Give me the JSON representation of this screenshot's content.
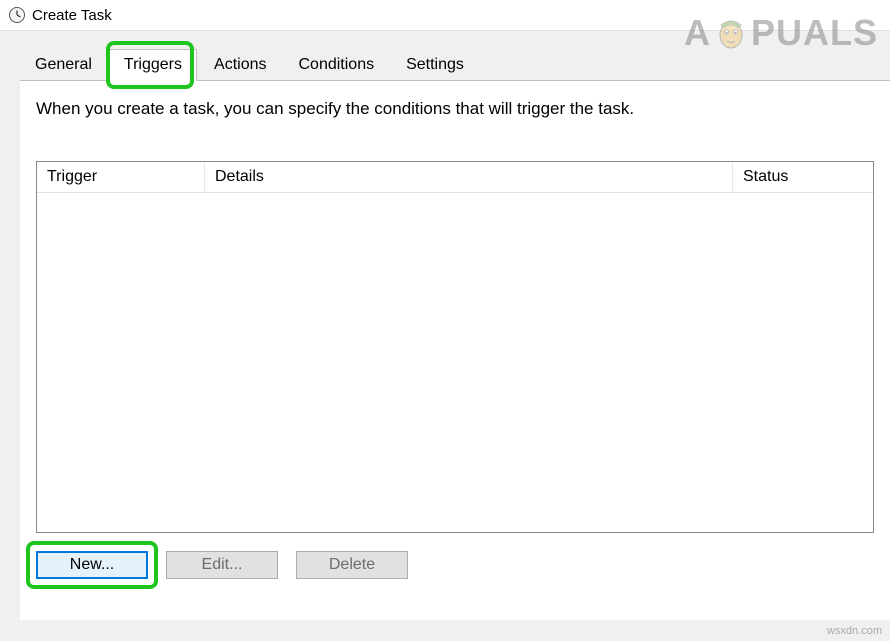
{
  "window": {
    "title": "Create Task"
  },
  "watermark": {
    "prefix": "A",
    "suffix": "PUALS"
  },
  "tabs": {
    "general": "General",
    "triggers": "Triggers",
    "actions": "Actions",
    "conditions": "Conditions",
    "settings": "Settings"
  },
  "panel": {
    "description": "When you create a task, you can specify the conditions that will trigger the task."
  },
  "table": {
    "columns": {
      "trigger": "Trigger",
      "details": "Details",
      "status": "Status"
    },
    "rows": []
  },
  "buttons": {
    "new": "New...",
    "edit": "Edit...",
    "delete": "Delete"
  },
  "source": "wsxdn.com"
}
